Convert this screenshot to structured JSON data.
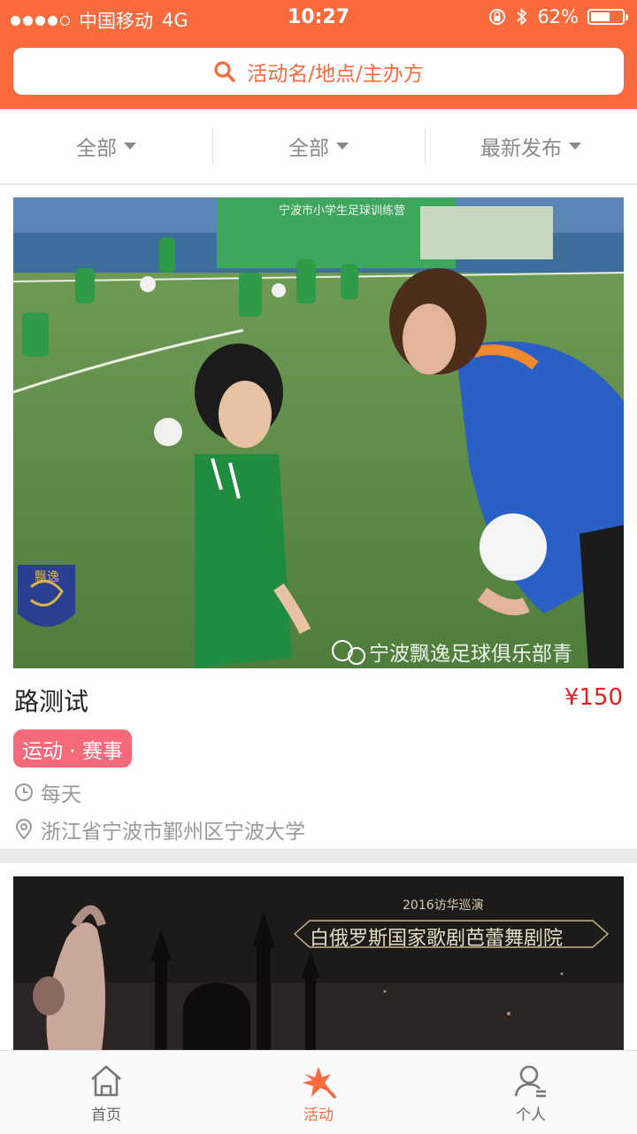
{
  "status_bar": {
    "carrier": "中国移动",
    "network": "4G",
    "time": "10:27",
    "battery": "62%",
    "battery_level": 0.62,
    "signal_bars": 4
  },
  "search": {
    "placeholder": "活动名/地点/主办方"
  },
  "filters": [
    {
      "label": "全部"
    },
    {
      "label": "全部"
    },
    {
      "label": "最新发布"
    }
  ],
  "activities": [
    {
      "title": "路测试",
      "price": "¥150",
      "tag": "运动 · 赛事",
      "time": "每天",
      "location": "浙江省宁波市鄞州区宁波大学",
      "image_caption": "宁波飘逸足球俱乐部青",
      "image_banner": "宁波市小学生足球训练营",
      "image_logo_text": "飘逸"
    },
    {
      "image_line1": "2016访华巡演",
      "image_line2": "白俄罗斯国家歌剧芭蕾舞剧院"
    }
  ],
  "tabs": [
    {
      "label": "首页",
      "icon": "home-icon"
    },
    {
      "label": "活动",
      "icon": "activity-icon"
    },
    {
      "label": "个人",
      "icon": "person-icon"
    }
  ],
  "colors": {
    "accent": "#fa6a3c",
    "price": "#e81f1f",
    "tag": "#f46a7a",
    "muted": "#999999"
  }
}
